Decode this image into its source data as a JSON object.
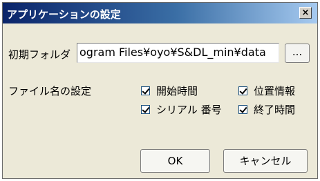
{
  "window": {
    "title": "アプリケーションの設定",
    "close_label": "×"
  },
  "initial_folder": {
    "label": "初期フォルダ",
    "value": "ogram Files¥oyo¥S&DL_min¥data",
    "browse_label": "..."
  },
  "filename_settings": {
    "label": "ファイル名の設定",
    "options": [
      {
        "label": "開始時間",
        "checked": true
      },
      {
        "label": "位置情報",
        "checked": true
      },
      {
        "label": "シリアル 番号",
        "checked": true
      },
      {
        "label": "終了時間",
        "checked": true
      }
    ]
  },
  "buttons": {
    "ok": "OK",
    "cancel": "キャンセル"
  }
}
